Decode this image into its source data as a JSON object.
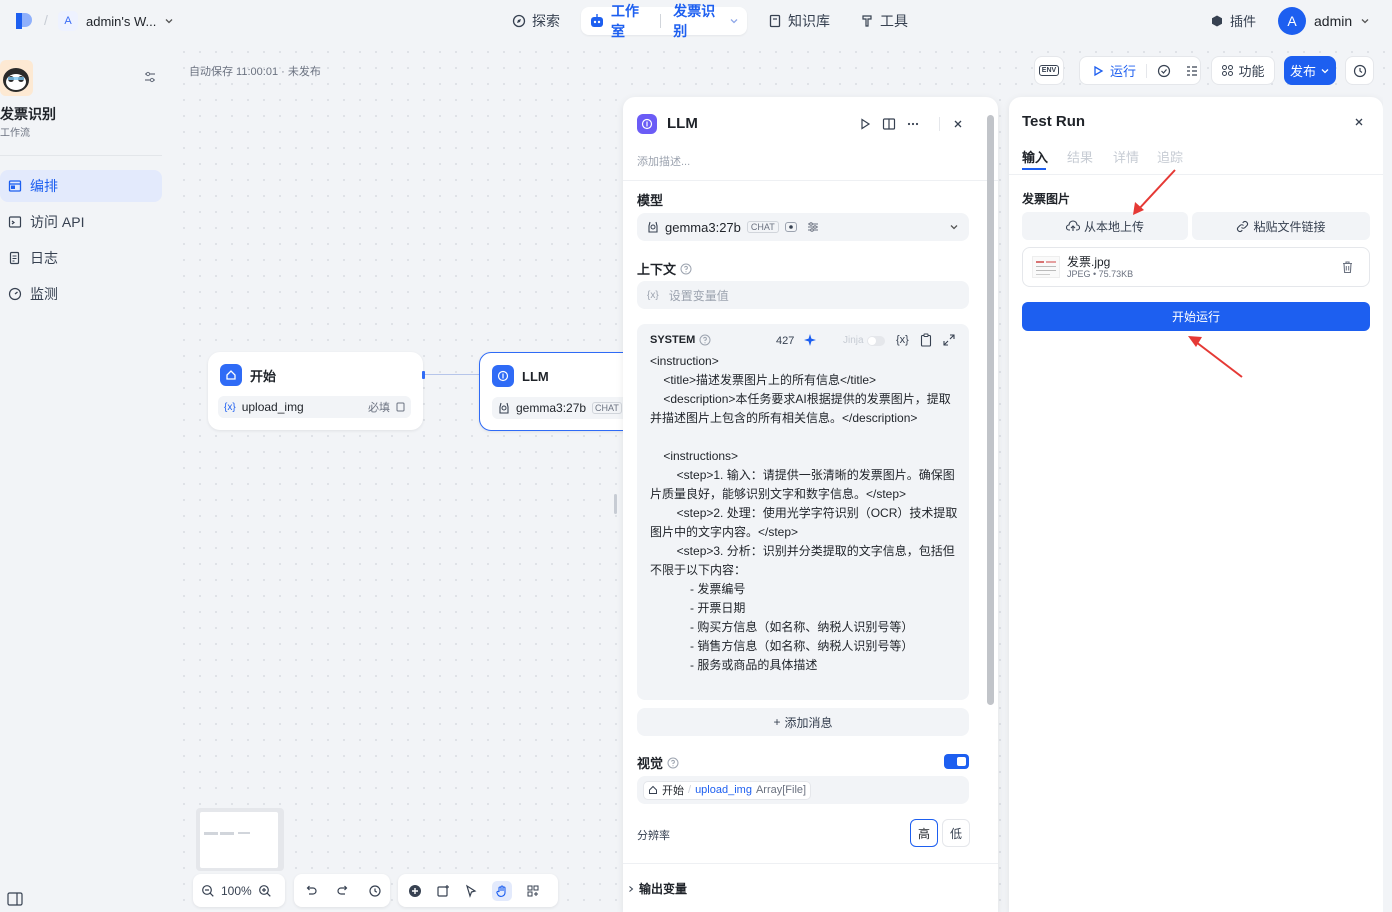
{
  "topbar": {
    "workspace_initial": "A",
    "workspace_name": "admin's W...",
    "nav_explore": "探索",
    "nav_studio": "工作室",
    "nav_app": "发票识别",
    "nav_knowledge": "知识库",
    "nav_tools": "工具",
    "plugin": "插件",
    "user_initial": "A",
    "user_name": "admin"
  },
  "sidebar": {
    "app_name": "发票识别",
    "app_type": "工作流",
    "items": [
      {
        "label": "编排",
        "icon": "layout-icon",
        "active": true
      },
      {
        "label": "访问 API",
        "icon": "terminal-icon",
        "active": false
      },
      {
        "label": "日志",
        "icon": "log-icon",
        "active": false
      },
      {
        "label": "监测",
        "icon": "monitor-icon",
        "active": false
      }
    ]
  },
  "canvas": {
    "autosave": "自动保存 11:00:01 · 未发布",
    "toolbar": {
      "env": "ENV",
      "run": "运行",
      "features": "功能",
      "publish": "发布"
    },
    "start_node": {
      "title": "开始",
      "var_prefix": "{x}",
      "var": "upload_img",
      "required": "必填"
    },
    "llm_node": {
      "title": "LLM",
      "model": "gemma3:27b",
      "tag": "CHAT"
    },
    "zoom": "100%"
  },
  "llm_panel": {
    "title": "LLM",
    "desc_placeholder": "添加描述...",
    "model_label": "模型",
    "model_name": "gemma3:27b",
    "model_tag": "CHAT",
    "context_label": "上下文",
    "context_prefix": "{x}",
    "context_placeholder": "设置变量值",
    "system_label": "SYSTEM",
    "token_count": "427",
    "jinja": "Jinja",
    "var_icon": "{x}",
    "prompt_lines": [
      "<instruction>",
      "    <title>描述发票图片上的所有信息</title>",
      "    <description>本任务要求AI根据提供的发票图片，提取",
      "并描述图片上包含的所有相关信息。</description>",
      "",
      "    <instructions>",
      "        <step>1. 输入：请提供一张清晰的发票图片。确保图",
      "片质量良好，能够识别文字和数字信息。</step>",
      "        <step>2. 处理：使用光学字符识别（OCR）技术提取",
      "图片中的文字内容。</step>",
      "        <step>3. 分析：识别并分类提取的文字信息，包括但",
      "不限于以下内容：",
      "            - 发票编号",
      "            - 开票日期",
      "            - 购买方信息（如名称、纳税人识别号等）",
      "            - 销售方信息（如名称、纳税人识别号等）",
      "            - 服务或商品的具体描述"
    ],
    "add_message": "添加消息",
    "vision_label": "视觉",
    "vision_enabled": true,
    "vision_var_node": "开始",
    "vision_var_name": "upload_img",
    "vision_var_type": "Array[File]",
    "resolution_label": "分辨率",
    "resolution_high": "高",
    "resolution_low": "低",
    "output_label": "输出变量"
  },
  "test_run": {
    "title": "Test Run",
    "tabs": [
      "输入",
      "结果",
      "详情",
      "追踪"
    ],
    "field_label": "发票图片",
    "upload_local": "从本地上传",
    "paste_link": "粘贴文件链接",
    "file_name": "发票.jpg",
    "file_meta": "JPEG • 75.73KB",
    "start_run": "开始运行"
  },
  "colors": {
    "accent": "#1d5ff0",
    "annotation_arrow": "#e53935"
  }
}
